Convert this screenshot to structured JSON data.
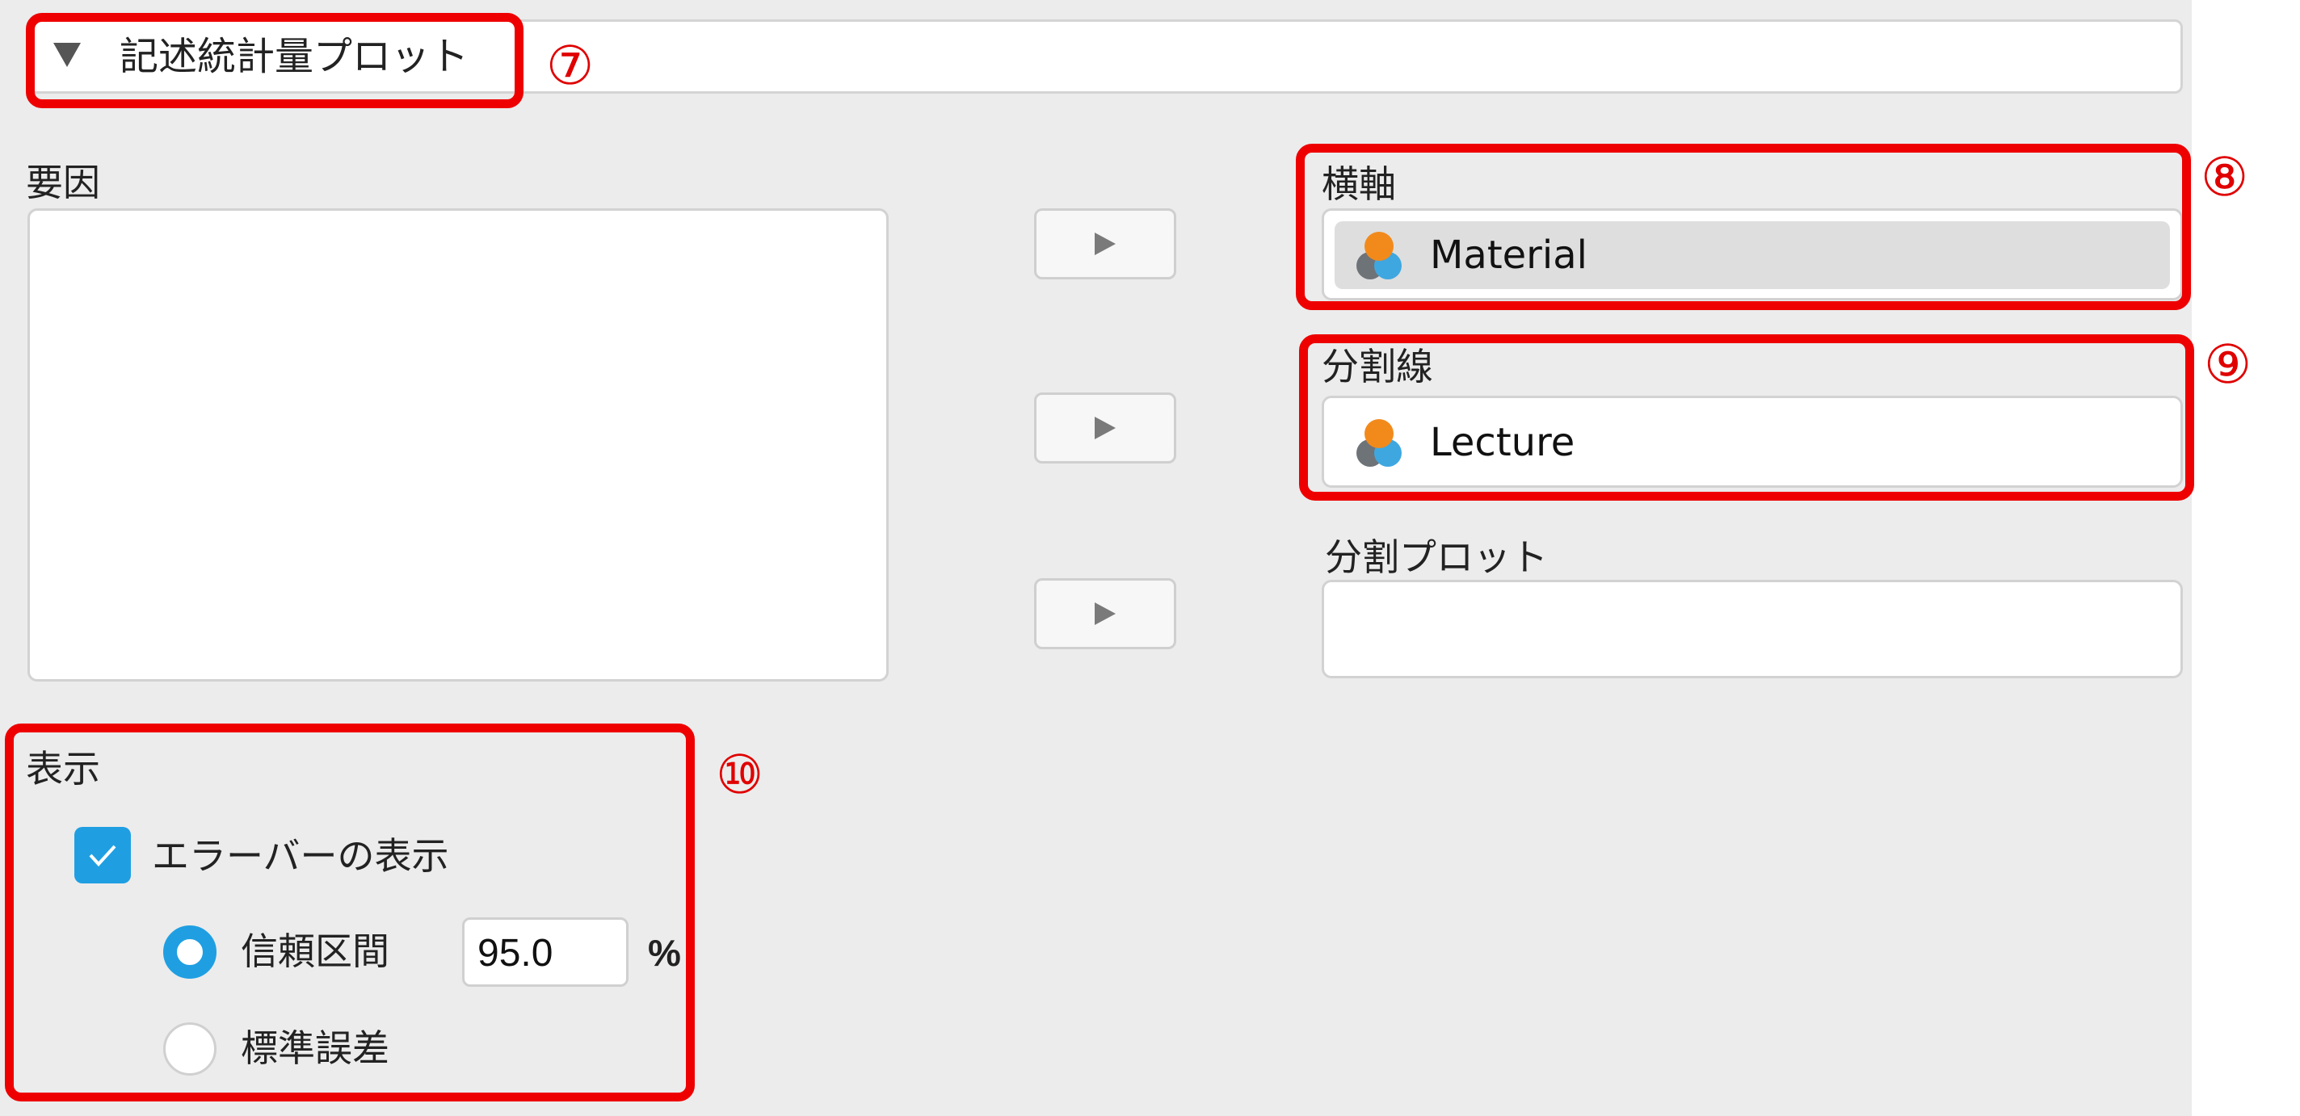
{
  "section": {
    "title": "記述統計量プロット",
    "annotation": "⑦"
  },
  "factors": {
    "label": "要因",
    "items": []
  },
  "horizontal_axis": {
    "label": "横軸",
    "variable": "Material",
    "annotation": "⑧"
  },
  "separate_lines": {
    "label": "分割線",
    "variable": "Lecture",
    "annotation": "⑨"
  },
  "separate_plots": {
    "label": "分割プロット",
    "items": []
  },
  "display": {
    "label": "表示",
    "annotation": "⑩",
    "error_bars": {
      "label": "エラーバーの表示",
      "checked": true
    },
    "confidence_interval": {
      "label": "信頼区間",
      "selected": true,
      "value": "95.0",
      "unit": "%"
    },
    "standard_error": {
      "label": "標準誤差",
      "selected": false
    }
  },
  "colors": {
    "annotation_red": "#ee0000",
    "accent_blue": "#1f9fe2",
    "panel_bg": "#ececec"
  },
  "icons": {
    "nominal_variable": "nominal-variable-icon",
    "move_arrow": "triangle-right-icon",
    "collapse": "triangle-down-icon"
  }
}
